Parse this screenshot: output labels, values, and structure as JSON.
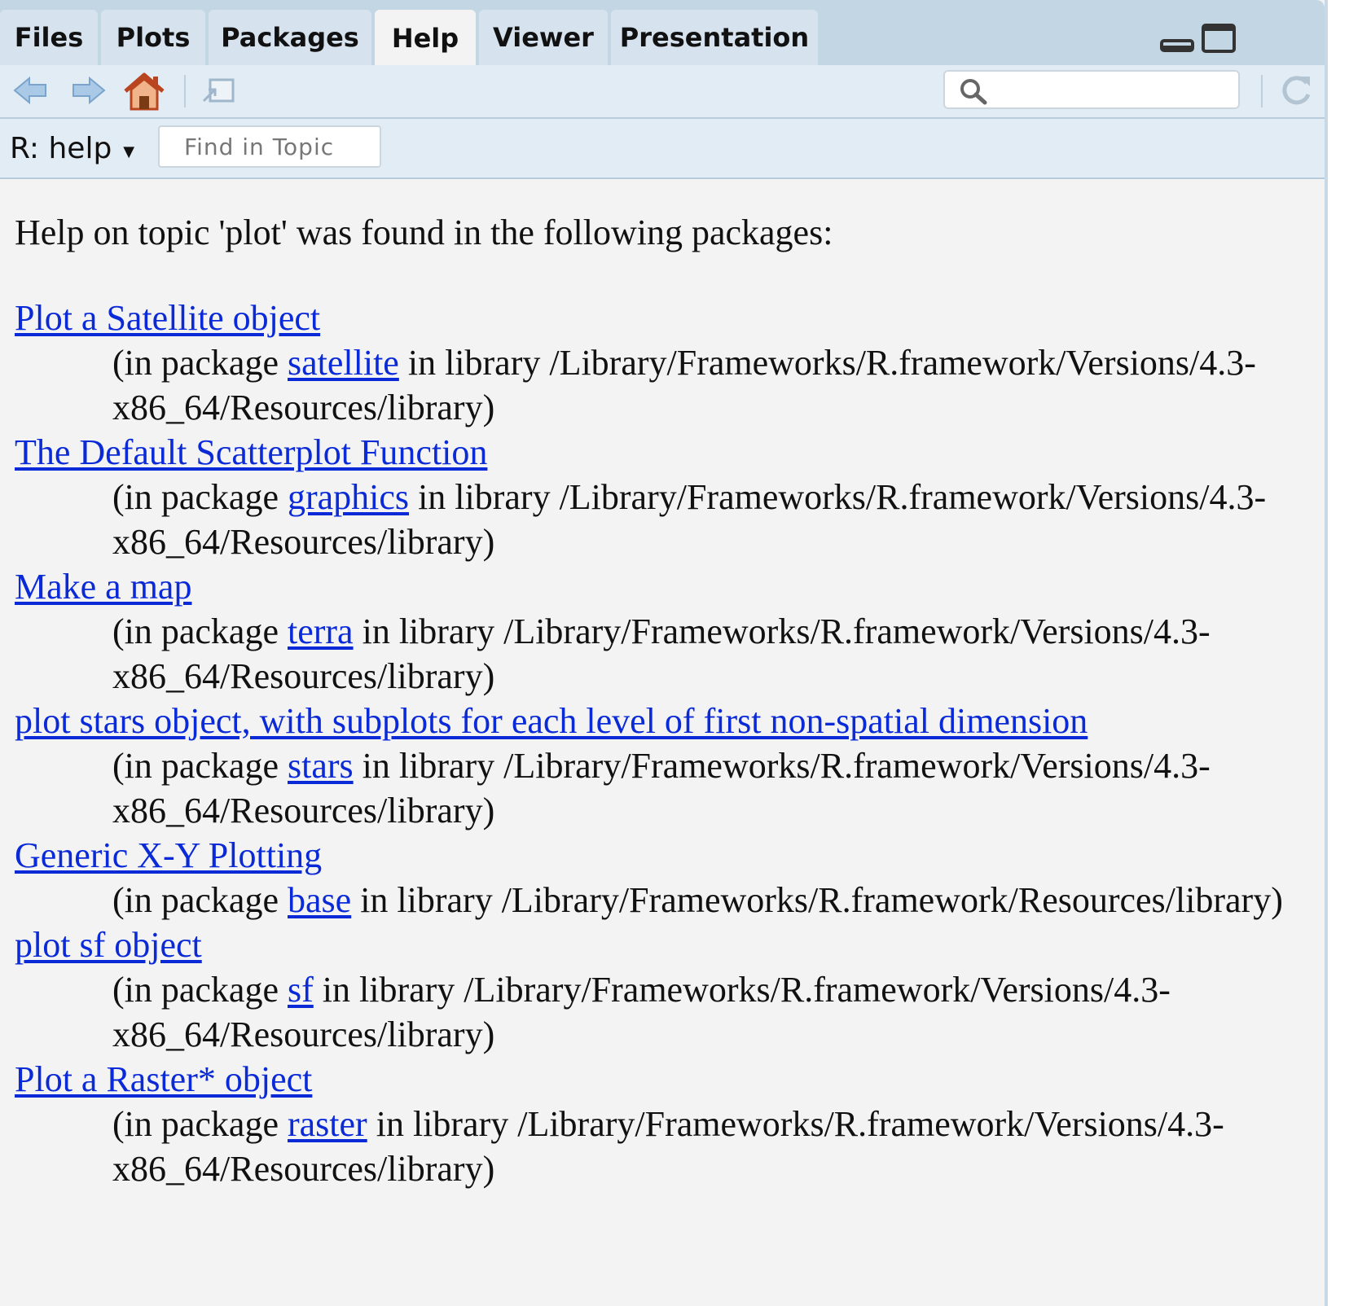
{
  "tabs": [
    {
      "label": "Files"
    },
    {
      "label": "Plots"
    },
    {
      "label": "Packages"
    },
    {
      "label": "Help",
      "active": true
    },
    {
      "label": "Viewer"
    },
    {
      "label": "Presentation"
    }
  ],
  "toolbar": {
    "icons": [
      "back-arrow-icon",
      "forward-arrow-icon",
      "home-icon",
      "popout-window-icon",
      "search-icon",
      "refresh-icon"
    ],
    "search": {
      "value": "",
      "placeholder": ""
    }
  },
  "topic_bar": {
    "selector_label": "R: help",
    "find_placeholder": "Find in Topic"
  },
  "content": {
    "intro": "Help on topic 'plot' was found in the following packages:",
    "entries": [
      {
        "title": "Plot a Satellite object",
        "prefix": "(in package ",
        "package": "satellite",
        "suffix": " in library /Library/Frameworks/R.framework/Versions/4.3-x86_64/Resources/library)"
      },
      {
        "title": "The Default Scatterplot Function",
        "prefix": "(in package ",
        "package": "graphics",
        "suffix": " in library /Library/Frameworks/R.framework/Versions/4.3-x86_64/Resources/library)"
      },
      {
        "title": "Make a map",
        "prefix": "(in package ",
        "package": "terra",
        "suffix": " in library /Library/Frameworks/R.framework/Versions/4.3-x86_64/Resources/library)"
      },
      {
        "title": "plot stars object, with subplots for each level of first non-spatial dimension",
        "prefix": "(in package ",
        "package": "stars",
        "suffix": " in library /Library/Frameworks/R.framework/Versions/4.3-x86_64/Resources/library)"
      },
      {
        "title": "Generic X-Y Plotting",
        "prefix": "(in package ",
        "package": "base",
        "suffix": " in library /Library/Frameworks/R.framework/Resources/library)"
      },
      {
        "title": "plot sf object",
        "prefix": "(in package ",
        "package": "sf",
        "suffix": " in library /Library/Frameworks/R.framework/Versions/4.3-x86_64/Resources/library)"
      },
      {
        "title": "Plot a Raster* object",
        "prefix": "(in package ",
        "package": "raster",
        "suffix": " in library /Library/Frameworks/R.framework/Versions/4.3-x86_64/Resources/library)"
      }
    ]
  },
  "colors": {
    "tabbar": "#c3d6e4",
    "toolbar": "#e2ecf4",
    "content_bg": "#f3f3f3",
    "link": "#0a2ad8"
  }
}
